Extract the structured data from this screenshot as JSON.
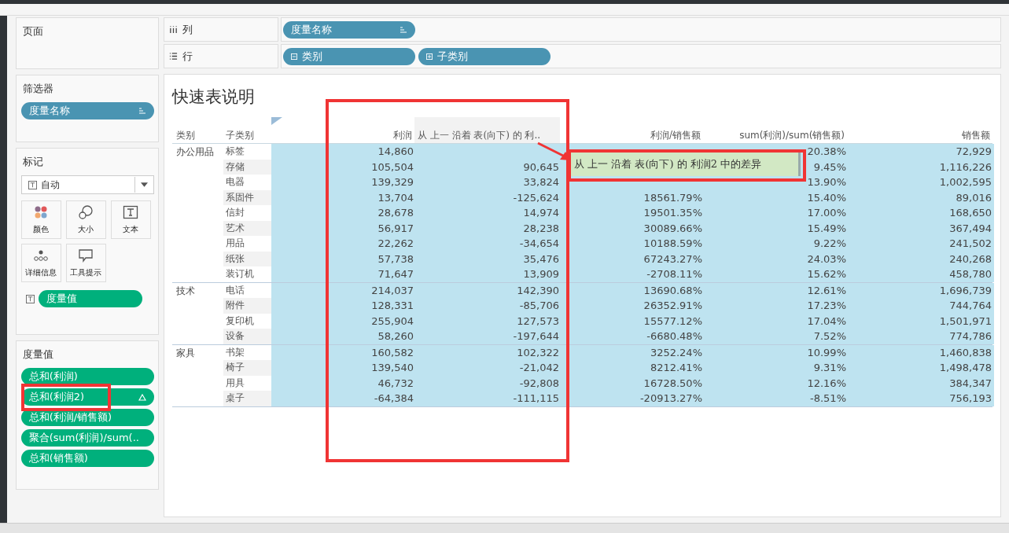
{
  "sidebar": {
    "pages": {
      "title": "页面"
    },
    "filters": {
      "title": "筛选器",
      "pills": [
        {
          "label": "度量名称"
        }
      ]
    },
    "marks": {
      "title": "标记",
      "type_select": {
        "value": "自动"
      },
      "buttons": [
        {
          "kind": "color",
          "label": "颜色"
        },
        {
          "kind": "size",
          "label": "大小"
        },
        {
          "kind": "text",
          "label": "文本"
        },
        {
          "kind": "detail",
          "label": "详细信息"
        },
        {
          "kind": "tooltip",
          "label": "工具提示"
        }
      ],
      "fields": [
        {
          "label": "度量值"
        }
      ]
    },
    "measure_values": {
      "title": "度量值",
      "pills": [
        {
          "label": "总和(利润)",
          "delta": false
        },
        {
          "label": "总和(利润2)",
          "delta": true
        },
        {
          "label": "总和(利润/销售额)",
          "delta": false
        },
        {
          "label": "聚合(sum(利润)/sum(..",
          "delta": false
        },
        {
          "label": "总和(销售额)",
          "delta": false
        }
      ]
    }
  },
  "shelves": [
    {
      "kind": "columns",
      "label": "列",
      "pills": [
        {
          "label": "度量名称",
          "sort": true
        }
      ]
    },
    {
      "kind": "rows",
      "label": "行",
      "pills": [
        {
          "label": "类别",
          "expanded": true
        },
        {
          "label": "子类别",
          "expanded": false
        }
      ]
    }
  ],
  "view": {
    "title": "快速表说明",
    "row_headers": [
      "类别",
      "子类别"
    ],
    "columns": [
      {
        "label": "利润",
        "highlighted": false
      },
      {
        "label": "从 上一 沿着 表(向下) 的 利..",
        "highlighted": true
      },
      {
        "label": "利润/销售额",
        "highlighted": false
      },
      {
        "label": "sum(利润)/sum(销售额)",
        "highlighted": false
      },
      {
        "label": "销售额",
        "highlighted": false
      }
    ],
    "groups": [
      {
        "category": "办公用品",
        "rows": [
          {
            "sub": "标签",
            "profit": "14,860",
            "agg": "20.38%",
            "sales": "72,929"
          },
          {
            "sub": "存储",
            "profit": "105,504",
            "profit2": "90,645",
            "agg": "9.45%",
            "sales": "1,116,226"
          },
          {
            "sub": "电器",
            "profit": "139,329",
            "profit2": "33,824",
            "agg": "13.90%",
            "sales": "1,002,595"
          },
          {
            "sub": "系固件",
            "profit": "13,704",
            "profit2": "-125,624",
            "ratio": "18561.79%",
            "agg": "15.40%",
            "sales": "89,016"
          },
          {
            "sub": "信封",
            "profit": "28,678",
            "profit2": "14,974",
            "ratio": "19501.35%",
            "agg": "17.00%",
            "sales": "168,650"
          },
          {
            "sub": "艺术",
            "profit": "56,917",
            "profit2": "28,238",
            "ratio": "30089.66%",
            "agg": "15.49%",
            "sales": "367,494"
          },
          {
            "sub": "用品",
            "profit": "22,262",
            "profit2": "-34,654",
            "ratio": "10188.59%",
            "agg": "9.22%",
            "sales": "241,502"
          },
          {
            "sub": "纸张",
            "profit": "57,738",
            "profit2": "35,476",
            "ratio": "67243.27%",
            "agg": "24.03%",
            "sales": "240,268"
          },
          {
            "sub": "装订机",
            "profit": "71,647",
            "profit2": "13,909",
            "ratio": "-2708.11%",
            "agg": "15.62%",
            "sales": "458,780"
          }
        ]
      },
      {
        "category": "技术",
        "rows": [
          {
            "sub": "电话",
            "profit": "214,037",
            "profit2": "142,390",
            "ratio": "13690.68%",
            "agg": "12.61%",
            "sales": "1,696,739"
          },
          {
            "sub": "附件",
            "profit": "128,331",
            "profit2": "-85,706",
            "ratio": "26352.91%",
            "agg": "17.23%",
            "sales": "744,764"
          },
          {
            "sub": "复印机",
            "profit": "255,904",
            "profit2": "127,573",
            "ratio": "15577.12%",
            "agg": "17.04%",
            "sales": "1,501,971"
          },
          {
            "sub": "设备",
            "profit": "58,260",
            "profit2": "-197,644",
            "ratio": "-6680.48%",
            "agg": "7.52%",
            "sales": "774,786"
          }
        ]
      },
      {
        "category": "家具",
        "rows": [
          {
            "sub": "书架",
            "profit": "160,582",
            "profit2": "102,322",
            "ratio": "3252.24%",
            "agg": "10.99%",
            "sales": "1,460,838"
          },
          {
            "sub": "椅子",
            "profit": "139,540",
            "profit2": "-21,042",
            "ratio": "8212.41%",
            "agg": "9.31%",
            "sales": "1,498,478"
          },
          {
            "sub": "用具",
            "profit": "46,732",
            "profit2": "-92,808",
            "ratio": "16728.50%",
            "agg": "12.16%",
            "sales": "384,347"
          },
          {
            "sub": "桌子",
            "profit": "-64,384",
            "profit2": "-111,115",
            "ratio": "-20913.27%",
            "agg": "-8.51%",
            "sales": "756,193"
          }
        ]
      }
    ],
    "tooltip": {
      "text": "从 上一 沿着 表(向下) 的 利润2 中的差异"
    }
  }
}
